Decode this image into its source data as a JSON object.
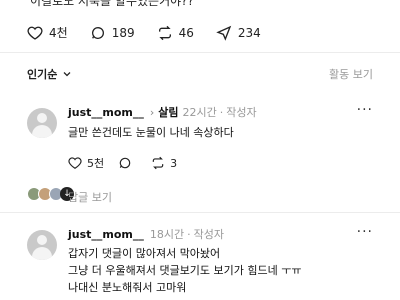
{
  "post": {
    "text_snippet": "이걸로도 저축을 할수있는거야??",
    "actions": [
      {
        "icon": "heart-icon",
        "count": "4천"
      },
      {
        "icon": "comment-icon",
        "count": "189"
      },
      {
        "icon": "repost-icon",
        "count": "46"
      },
      {
        "icon": "share-icon",
        "count": "234"
      }
    ]
  },
  "sort": {
    "label": "인기순",
    "activity_label": "활동 보기"
  },
  "comments": [
    {
      "username": "just__mom__",
      "reply_to": "살림",
      "time": "22시간",
      "author_tag": "작성자",
      "lines": [
        "글만 쓴건데도 눈물이 나네 속상하다"
      ],
      "actions": [
        {
          "icon": "heart-icon",
          "count": "5천"
        },
        {
          "icon": "comment-icon",
          "count": ""
        },
        {
          "icon": "repost-icon",
          "count": "3"
        }
      ],
      "view_replies": "답글 보기"
    },
    {
      "username": "just__mom__",
      "time": "18시간",
      "author_tag": "작성자",
      "lines": [
        "갑자기 댓글이 많아져서 막아놨어",
        "그냥 더 우울해져서 댓글보기도 보기가 힘드네 ㅜㅠ",
        "나대신 분노해줘서 고마워"
      ]
    }
  ],
  "more_label": "···",
  "colors": {
    "muted": "#999999",
    "text": "#111111",
    "avatar": "#c9c9c9"
  }
}
